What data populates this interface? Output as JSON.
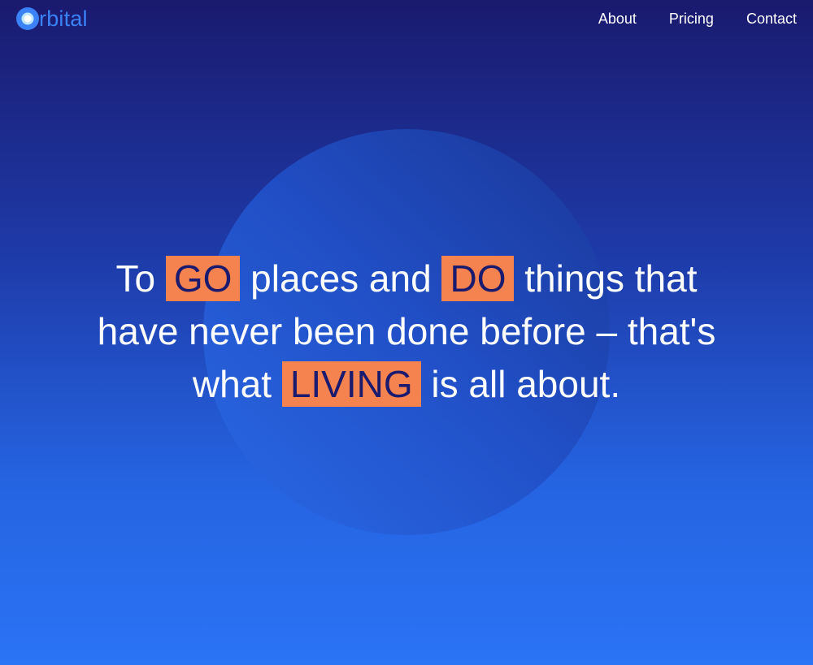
{
  "brand": {
    "name": "rbital",
    "logo_icon": "orbital-ring-icon",
    "color": "#3b82f6"
  },
  "nav": {
    "items": [
      {
        "label": "About"
      },
      {
        "label": "Pricing"
      },
      {
        "label": "Contact"
      }
    ]
  },
  "hero": {
    "line1_a": "To ",
    "line1_hl1": "GO",
    "line1_b": " places and ",
    "line1_hl2": "DO",
    "line1_c": " things that",
    "line2": "have never been done before – that's",
    "line3_a": "what ",
    "line3_hl": "LIVING",
    "line3_b": " is all about."
  },
  "colors": {
    "highlight_bg": "#f5834f",
    "highlight_text": "#1a1a6e",
    "background_top": "#1a1a6e",
    "background_bottom": "#2a74f6"
  }
}
